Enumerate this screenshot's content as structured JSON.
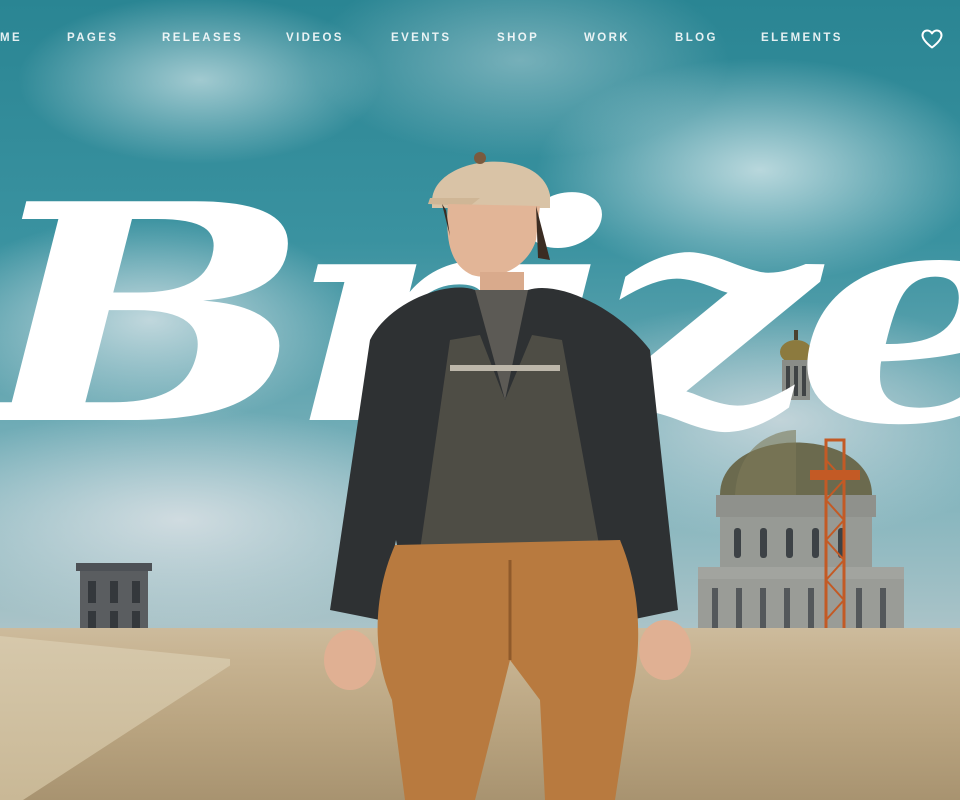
{
  "nav": {
    "items": [
      "ME",
      "PAGES",
      "RELEASES",
      "VIDEOS",
      "EVENTS",
      "SHOP",
      "WORK",
      "BLOG",
      "ELEMENTS"
    ],
    "wishlist_icon": "heart-icon"
  },
  "hero": {
    "brand_text": "Brize"
  },
  "colors": {
    "sky": "#2e8796",
    "nav_text": "#ffffff",
    "brand_script": "#ffffff",
    "ledge": "#c6b290"
  }
}
